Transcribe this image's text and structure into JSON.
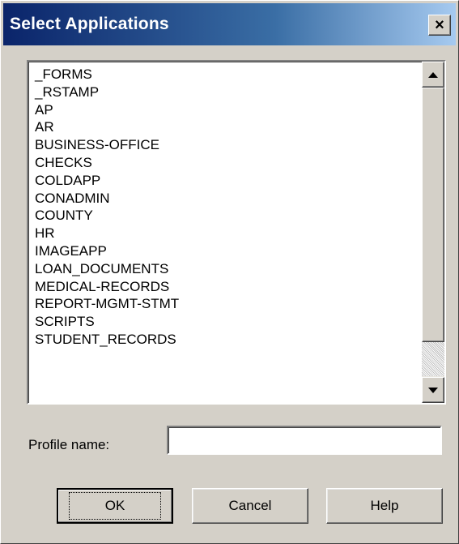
{
  "window": {
    "title": "Select Applications",
    "close_label": "×"
  },
  "applications": {
    "items": [
      "_FORMS",
      "_RSTAMP",
      "AP",
      "AR",
      "BUSINESS-OFFICE",
      "CHECKS",
      "COLDAPP",
      "CONADMIN",
      "COUNTY",
      "HR",
      "IMAGEAPP",
      "LOAN_DOCUMENTS",
      "MEDICAL-RECORDS",
      "REPORT-MGMT-STMT",
      "SCRIPTS",
      "STUDENT_RECORDS"
    ]
  },
  "profile": {
    "label": "Profile name:",
    "value": ""
  },
  "buttons": {
    "ok": "OK",
    "cancel": "Cancel",
    "help": "Help"
  },
  "colors": {
    "titlebar_start": "#0a246a",
    "titlebar_end": "#a6caf0",
    "dialog_face": "#d4d0c8"
  }
}
